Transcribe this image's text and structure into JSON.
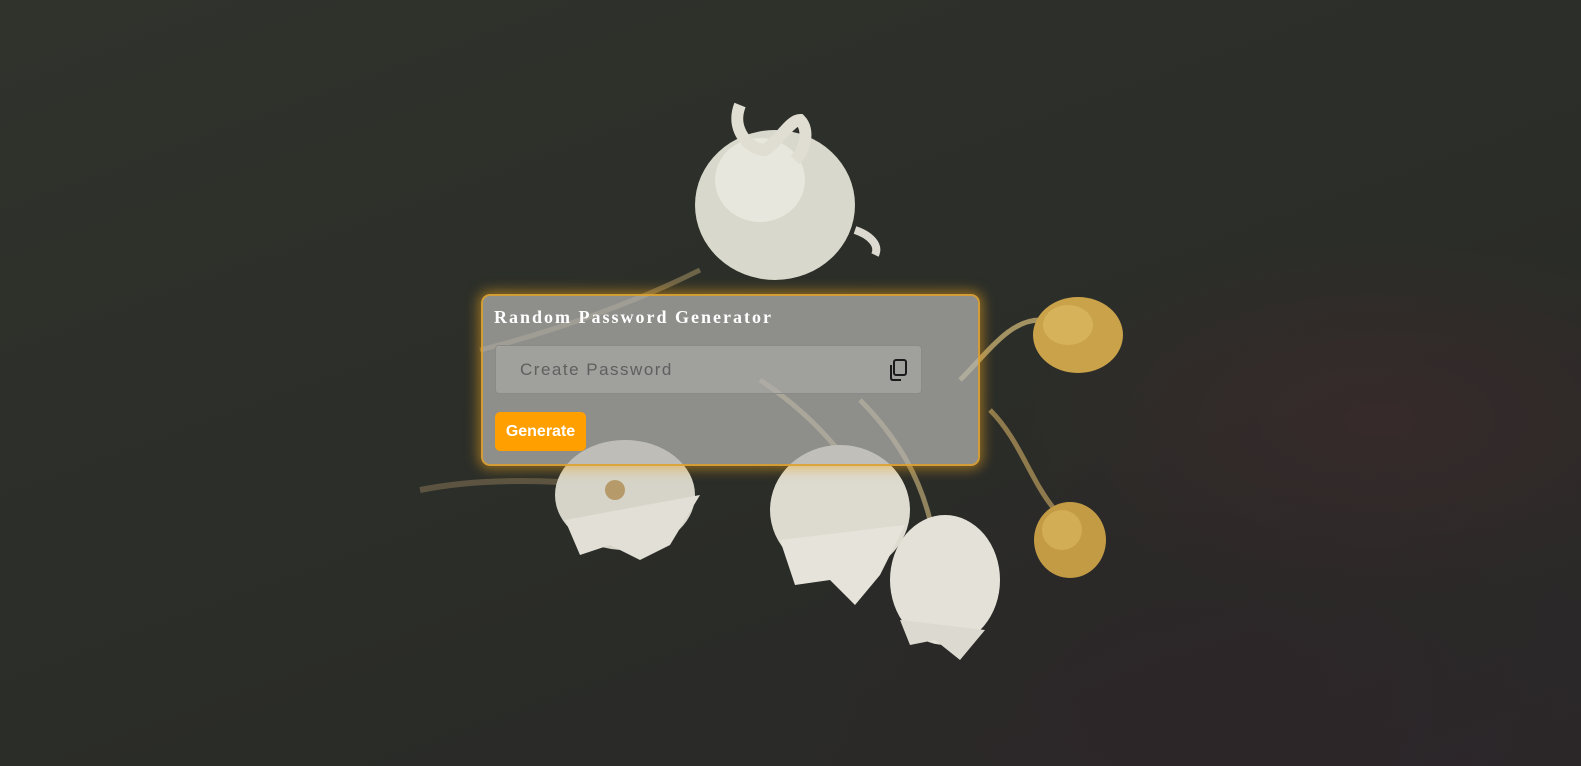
{
  "generator": {
    "title": "Random Password Generator",
    "password_value": "",
    "password_placeholder": "Create Password",
    "copy_icon": "copy-icon",
    "generate_label": "Generate"
  },
  "colors": {
    "accent": "#ff9f00",
    "card_border_glow": "#e0a028",
    "title_text": "#ffffff"
  }
}
